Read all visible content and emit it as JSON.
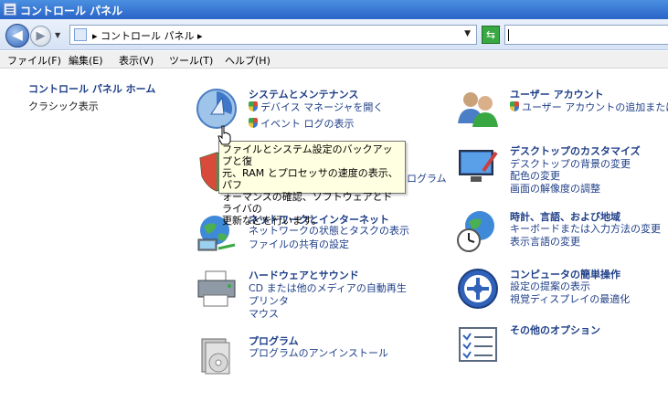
{
  "window": {
    "title": "コントロール パネル"
  },
  "address_bar": {
    "path": "▸ コントロール パネル ▸",
    "search_value": ""
  },
  "menu": [
    "ファイル(F)",
    "編集(E)",
    "表示(V)",
    "ツール(T)",
    "ヘルプ(H)"
  ],
  "sidebar": {
    "home_label": "コントロール パネル ホーム",
    "classic_label": "クラシック表示"
  },
  "categories": {
    "system": {
      "title": "システムとメンテナンス",
      "links": [
        "デバイス マネージャを開く",
        "イベント ログの表示"
      ]
    },
    "security": {
      "links_partial": "ログラム"
    },
    "network": {
      "title": "ネットワークとインターネット",
      "links": [
        "ネットワークの状態とタスクの表示",
        "ファイルの共有の設定"
      ]
    },
    "hardware": {
      "title": "ハードウェアとサウンド",
      "links": [
        "CD または他のメディアの自動再生",
        "プリンタ",
        "マウス"
      ]
    },
    "programs": {
      "title": "プログラム",
      "links": [
        "プログラムのアンインストール"
      ]
    },
    "user_accounts": {
      "title": "ユーザー アカウント",
      "links": [
        "ユーザー アカウントの追加または削"
      ]
    },
    "appearance": {
      "title": "デスクトップのカスタマイズ",
      "links": [
        "デスクトップの背景の変更",
        "配色の変更",
        "画面の解像度の調整"
      ]
    },
    "clock": {
      "title": "時計、言語、および地域",
      "links": [
        "キーボードまたは入力方法の変更",
        "表示言語の変更"
      ]
    },
    "ease": {
      "title": "コンピュータの簡単操作",
      "links": [
        "設定の提案の表示",
        "視覚ディスプレイの最適化"
      ]
    },
    "other": {
      "title": "その他のオプション"
    }
  },
  "tooltip": {
    "lines": [
      "ファイルとシステム設定のバックアップと復",
      "元、RAM とプロセッサの速度の表示、パフ",
      "ォーマンスの確認、ソフトウェアとドライバの",
      "更新などを行います。"
    ]
  }
}
